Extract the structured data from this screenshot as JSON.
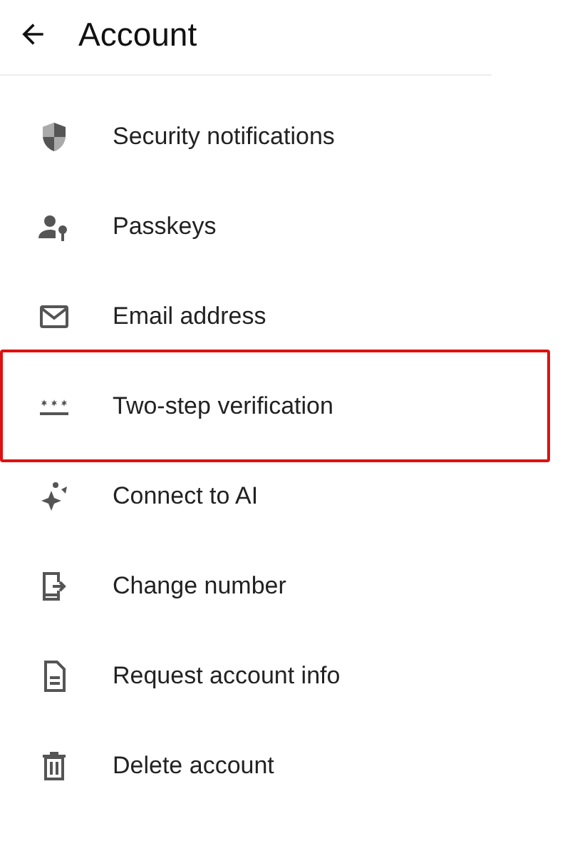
{
  "header": {
    "title": "Account"
  },
  "items": [
    {
      "label": "Security notifications",
      "highlighted": false
    },
    {
      "label": "Passkeys",
      "highlighted": false
    },
    {
      "label": "Email address",
      "highlighted": false
    },
    {
      "label": "Two-step verification",
      "highlighted": true
    },
    {
      "label": "Connect to AI",
      "highlighted": false
    },
    {
      "label": "Change number",
      "highlighted": false
    },
    {
      "label": "Request account info",
      "highlighted": false
    },
    {
      "label": "Delete account",
      "highlighted": false
    }
  ]
}
